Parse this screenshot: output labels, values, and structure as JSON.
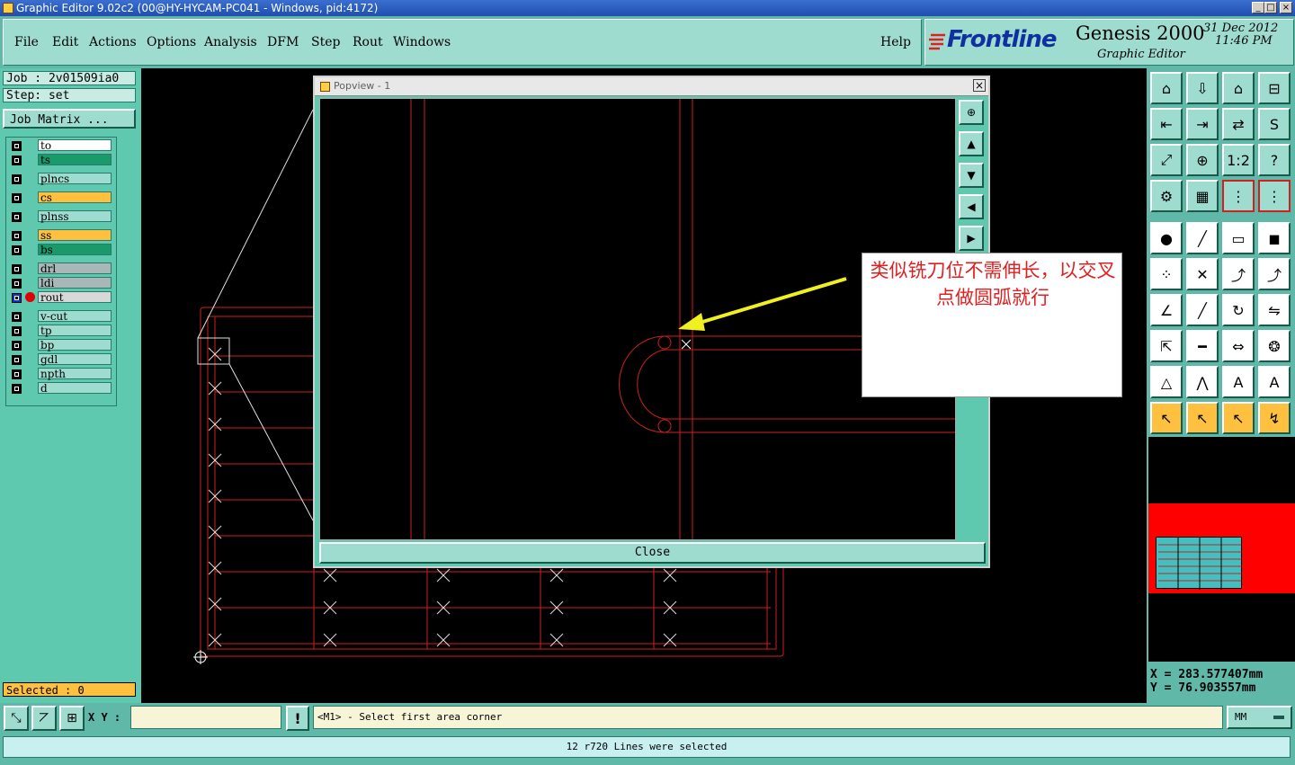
{
  "window": {
    "title": "Graphic Editor 9.02c2 (00@HY-HYCAM-PC041 - Windows, pid:4172)",
    "controls": [
      "_",
      "□",
      "×"
    ]
  },
  "menu": {
    "items": [
      "File",
      "Edit",
      "Actions",
      "Options",
      "Analysis",
      "DFM",
      "Step",
      "Rout",
      "Windows"
    ],
    "help": "Help"
  },
  "brand": {
    "logo": "Frontline",
    "product": "Genesis 2000",
    "subtitle": "Graphic Editor",
    "date": "31 Dec 2012",
    "time": "11:46 PM"
  },
  "job": {
    "job_label": "Job : 2v01509ia0",
    "step_label": "Step: set",
    "matrix_button": "Job Matrix ..."
  },
  "layers": [
    {
      "name": "to",
      "color": "#ffffff"
    },
    {
      "name": "ts",
      "color": "#1a9a6a"
    },
    {
      "name": "plncs",
      "color": "#9fdcd0"
    },
    {
      "name": "cs",
      "color": "#ffc040"
    },
    {
      "name": "plnss",
      "color": "#9fdcd0"
    },
    {
      "name": "ss",
      "color": "#ffc040"
    },
    {
      "name": "bs",
      "color": "#1a9a6a"
    },
    {
      "name": "drl",
      "color": "#a8b8b8"
    },
    {
      "name": "ldi",
      "color": "#a8b8b8"
    },
    {
      "name": "rout",
      "color": "#d8d8d8"
    },
    {
      "name": "v-cut",
      "color": "#9fdcd0"
    },
    {
      "name": "tp",
      "color": "#9fdcd0"
    },
    {
      "name": "bp",
      "color": "#9fdcd0"
    },
    {
      "name": "gdl",
      "color": "#9fdcd0"
    },
    {
      "name": "npth",
      "color": "#9fdcd0"
    },
    {
      "name": "d",
      "color": "#9fdcd0"
    }
  ],
  "selected_label": "Selected : 0",
  "popview": {
    "title": "Popview - 1",
    "close_label": "Close",
    "annotation": "类似铣刀位不需伸长，以交叉点做圆弧就行"
  },
  "coords": {
    "x": "X = 283.577407mm",
    "y": "Y = 76.903557mm"
  },
  "prompt": {
    "xy_label": "X Y :",
    "xy_value": "",
    "excl": "!",
    "message": "<M1> - Select first area corner",
    "units": "MM"
  },
  "status_message": "12 r720 Lines were selected"
}
